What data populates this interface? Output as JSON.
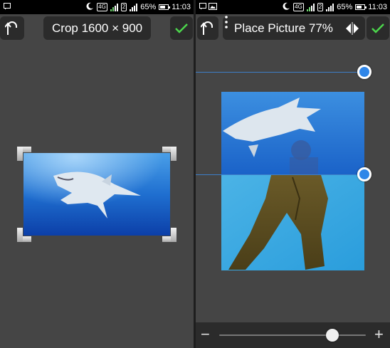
{
  "status_bar": {
    "network_badge": "4G",
    "sim2_badge": "2",
    "battery_percent": "65%",
    "time": "11:03"
  },
  "left_screen": {
    "toolbar": {
      "undo_icon": "undo-arrow-icon",
      "title": "Crop 1600 × 900",
      "confirm_icon": "check-icon"
    },
    "image": "shark-underwater-photo"
  },
  "right_screen": {
    "toolbar": {
      "undo_icon": "undo-arrow-icon",
      "menu_icon": "vertical-dots-icon",
      "title": "Place Picture 77%",
      "mirror_icon": "flip-horizontal-icon",
      "confirm_icon": "check-icon"
    },
    "images": [
      "shark-underwater-photo",
      "diver-legs-photo"
    ],
    "bottom_bar": {
      "minus_label": "−",
      "plus_label": "+",
      "slider_value_fraction": 0.77
    }
  },
  "colors": {
    "accent_check": "#4cd64c",
    "handle_blue": "#2f86e8",
    "guide_line": "#3d7fc8",
    "background": "#454545",
    "toolbar": "#2b2b2b"
  }
}
